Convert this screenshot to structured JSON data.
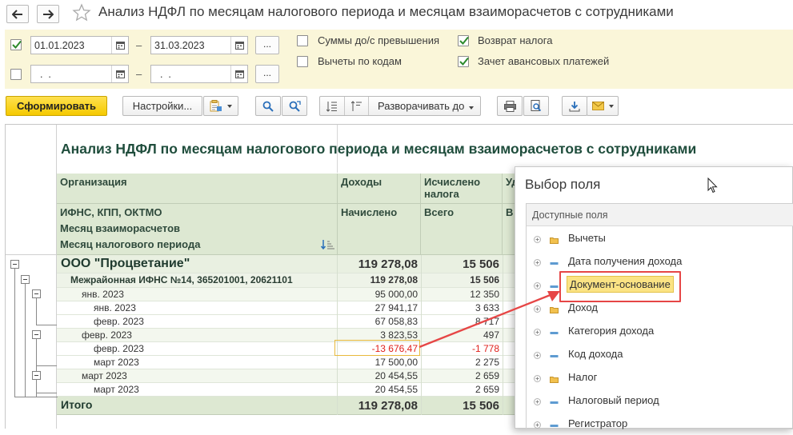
{
  "window": {
    "title": "Анализ НДФЛ по месяцам налогового периода и месяцам взаиморасчетов с сотрудниками"
  },
  "filters": {
    "period1": {
      "checked": true,
      "from": "01.01.2023",
      "to": "31.03.2023"
    },
    "period2": {
      "checked": false,
      "from": "  .  .",
      "to": "  .  ."
    },
    "dash": "–",
    "dots": "...",
    "options": [
      {
        "label": "Суммы до/с превышения",
        "checked": false
      },
      {
        "label": "Вычеты по кодам",
        "checked": false
      },
      {
        "label": "Возврат налога",
        "checked": true
      },
      {
        "label": "Зачет авансовых платежей",
        "checked": true
      }
    ]
  },
  "toolbar": {
    "generate_label": "Сформировать",
    "settings_label": "Настройки...",
    "expand_label": "Разворачивать до"
  },
  "report": {
    "title": "Анализ НДФЛ по месяцам налогового периода и месяцам взаиморасчетов с сотрудниками",
    "headers": {
      "org": "Организация",
      "ifns": "ИФНС, КПП, ОКТМО",
      "month_settle": "Месяц взаиморасчетов",
      "month_tax": "Месяц налогового периода",
      "income": "Доходы",
      "accrued": "Начислено",
      "calc_tax": "Исчислено налога",
      "total": "Всего",
      "col3_top": "Уд",
      "col3_sub": "В"
    },
    "rows": [
      {
        "label": "ООО \"Процветание\"",
        "income": "119 278,08",
        "tax": "15 506"
      },
      {
        "label": "Межрайонная ИФНС №14, 365201001, 20621101",
        "income": "119 278,08",
        "tax": "15 506"
      },
      {
        "label": "янв. 2023",
        "income": "95 000,00",
        "tax": "12 350"
      },
      {
        "label": "янв. 2023",
        "income": "27 941,17",
        "tax": "3 633"
      },
      {
        "label": "февр. 2023",
        "income": "67 058,83",
        "tax": "8 717"
      },
      {
        "label": "февр. 2023",
        "income": "3 823,53",
        "tax": "497"
      },
      {
        "label": "февр. 2023",
        "income": "-13 676,47",
        "tax": "-1 778"
      },
      {
        "label": "март 2023",
        "income": "17 500,00",
        "tax": "2 275"
      },
      {
        "label": "март 2023",
        "income": "20 454,55",
        "tax": "2 659"
      },
      {
        "label": "март 2023",
        "income": "20 454,55",
        "tax": "2 659"
      }
    ],
    "total": {
      "label": "Итого",
      "income": "119 278,08",
      "tax": "15 506"
    }
  },
  "field_chooser": {
    "title": "Выбор поля",
    "list_header": "Доступные поля",
    "items": [
      {
        "label": "Вычеты",
        "icon": "folder-icon"
      },
      {
        "label": "Дата получения дохода",
        "icon": "field-icon"
      },
      {
        "label": "Документ-основание",
        "icon": "field-icon",
        "selected": true
      },
      {
        "label": "Доход",
        "icon": "folder-icon"
      },
      {
        "label": "Категория дохода",
        "icon": "field-icon"
      },
      {
        "label": "Код дохода",
        "icon": "field-icon"
      },
      {
        "label": "Налог",
        "icon": "folder-icon"
      },
      {
        "label": "Налоговый период",
        "icon": "field-icon"
      },
      {
        "label": "Регистратор",
        "icon": "field-icon"
      }
    ]
  },
  "colors": {
    "accent_yellow": "#f5c900",
    "header_green": "#dde8d2",
    "title_green": "#1f4d3c",
    "negative_red": "#e0201b",
    "highlight_red": "#e64646"
  }
}
